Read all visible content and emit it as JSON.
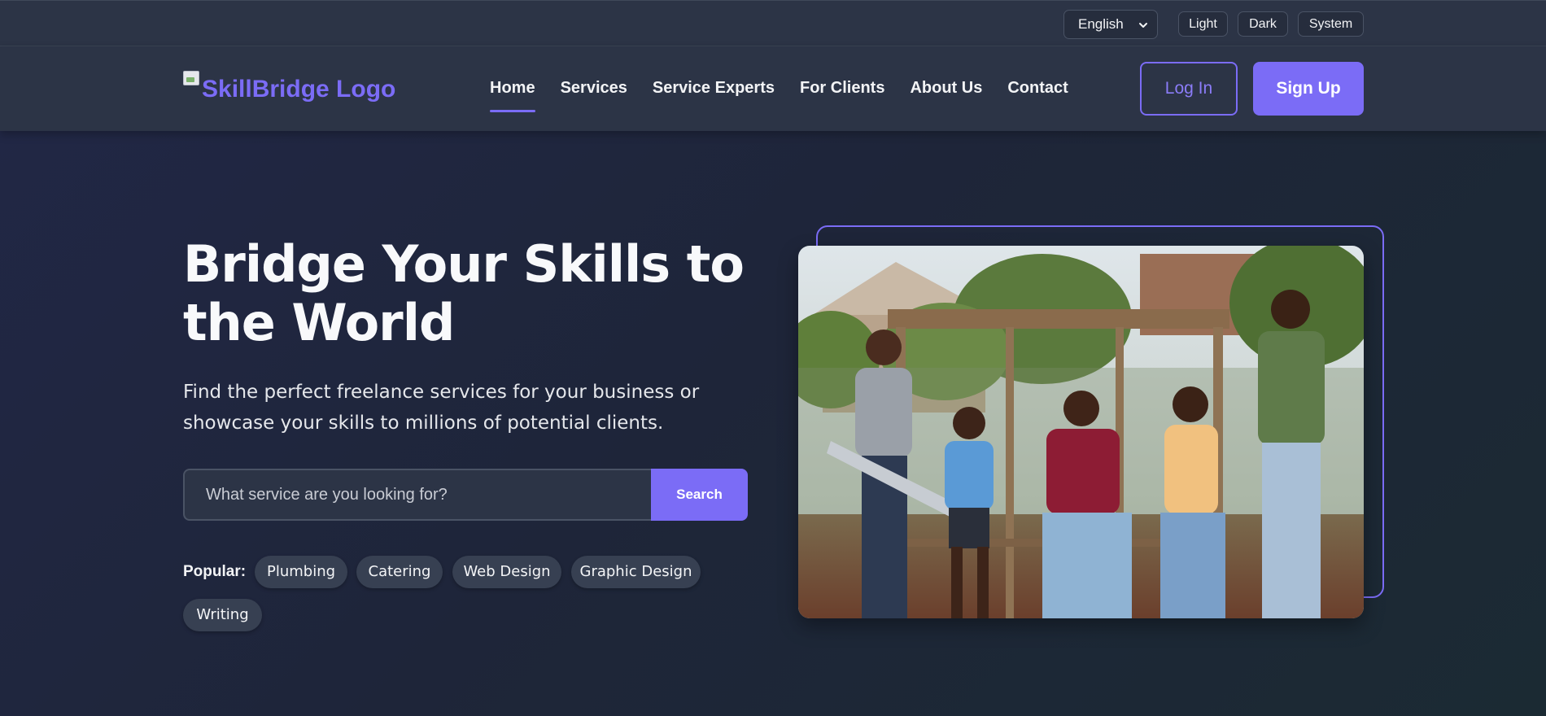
{
  "top_bar": {
    "language": "English",
    "theme_buttons": [
      "Light",
      "Dark",
      "System"
    ]
  },
  "header": {
    "logo_alt": "SkillBridge Logo",
    "nav": [
      "Home",
      "Services",
      "Service Experts",
      "For Clients",
      "About Us",
      "Contact"
    ],
    "active_nav": "Home",
    "login": "Log In",
    "signup": "Sign Up"
  },
  "hero": {
    "title": "Bridge Your Skills to the World",
    "subtitle": "Find the perfect freelance services for your business or showcase your skills to millions of potential clients.",
    "search_placeholder": "What service are you looking for?",
    "search_button": "Search",
    "popular_label": "Popular:",
    "popular_tags": [
      "Plumbing",
      "Catering",
      "Web Design",
      "Graphic Design",
      "Writing"
    ]
  },
  "colors": {
    "accent": "#7b6cf6",
    "header_bg": "#2c3446",
    "hero_bg": "#1f2638"
  }
}
